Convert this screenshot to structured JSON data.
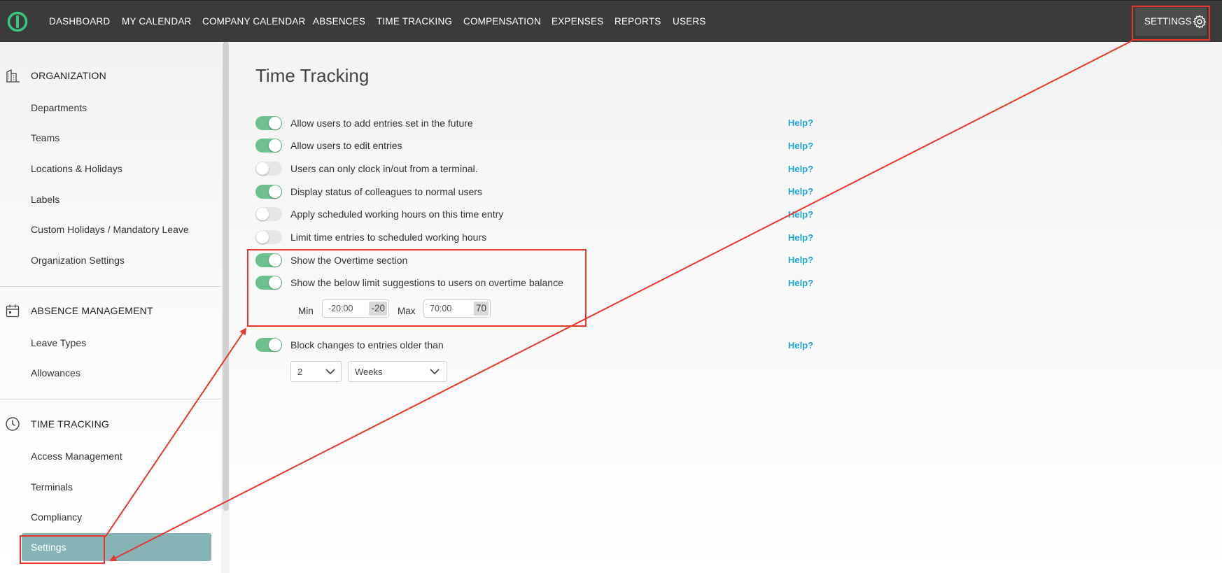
{
  "nav": {
    "items": [
      "DASHBOARD",
      "MY CALENDAR",
      "COMPANY CALENDAR",
      "ABSENCES",
      "TIME TRACKING",
      "COMPENSATION",
      "EXPENSES",
      "REPORTS",
      "USERS"
    ],
    "settings_label": "SETTINGS"
  },
  "sidebar": {
    "organization": {
      "title": "ORGANIZATION",
      "items": [
        "Departments",
        "Teams",
        "Locations & Holidays",
        "Labels",
        "Custom Holidays / Mandatory Leave",
        "Organization Settings"
      ]
    },
    "absence": {
      "title": "ABSENCE MANAGEMENT",
      "items": [
        "Leave Types",
        "Allowances"
      ]
    },
    "time": {
      "title": "TIME TRACKING",
      "items": [
        "Access Management",
        "Terminals",
        "Compliancy"
      ],
      "active": "Settings"
    }
  },
  "main": {
    "title": "Time Tracking",
    "help_label": "Help?",
    "settings": [
      {
        "label": "Allow users to add entries set in the future",
        "enabled": true
      },
      {
        "label": "Allow users to edit entries",
        "enabled": true
      },
      {
        "label": "Users can only clock in/out from a terminal.",
        "enabled": false
      },
      {
        "label": "Display status of colleagues to normal users",
        "enabled": true
      },
      {
        "label": "Apply scheduled working hours on this time entry",
        "enabled": false
      },
      {
        "label": "Limit time entries to scheduled working hours",
        "enabled": false
      },
      {
        "label": "Show the Overtime section",
        "enabled": true
      },
      {
        "label": "Show the below limit suggestions to users on overtime balance",
        "enabled": true
      },
      {
        "label": "Block changes to entries older than",
        "enabled": true
      }
    ],
    "overtime_limits": {
      "min_label": "Min",
      "min_value": "-20:00",
      "min_chip": "-20",
      "max_label": "Max",
      "max_value": "70:00",
      "max_chip": "70"
    },
    "block_changes": {
      "amount": "2",
      "unit": "Weeks"
    }
  },
  "colors": {
    "topbar": "#3b3b3b",
    "toggle_on": "#6cc18e",
    "toggle_off": "#e6e6e6",
    "help_link": "#1fa4d6",
    "active_item": "#86b4b6",
    "annotation": "#e8382e"
  },
  "icons": {
    "logo": "logo-icon",
    "settings": "gear-icon",
    "organization": "building-icon",
    "absence": "calendar-icon",
    "time": "clock-icon",
    "dropdown": "chevron-down-icon"
  }
}
